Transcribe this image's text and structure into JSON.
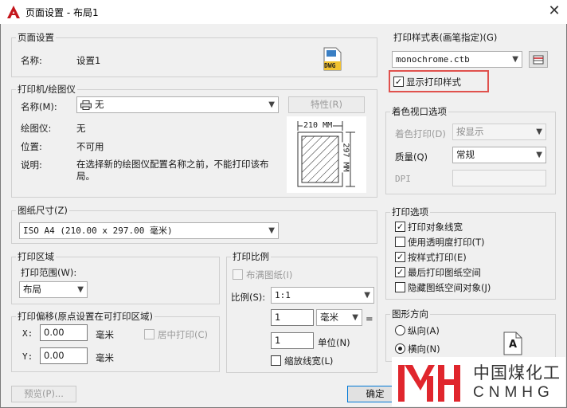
{
  "window": {
    "title": "页面设置 - 布局1",
    "close": "✕"
  },
  "page_setup": {
    "group": "页面设置",
    "name_label": "名称:",
    "name_value": "设置1",
    "icon_text": "DWG"
  },
  "printer": {
    "group": "打印机/绘图仪",
    "name_label": "名称(M):",
    "name_value": "无",
    "props_button": "特性(R)",
    "plotter_label": "绘图仪:",
    "plotter_value": "无",
    "location_label": "位置:",
    "location_value": "不可用",
    "desc_label": "说明:",
    "desc_value": "在选择新的绘图仪配置名称之前，不能打印该布局。",
    "paper_w": "210 MM",
    "paper_h": "297 MM"
  },
  "paper_size": {
    "group": "图纸尺寸(Z)",
    "value": "ISO A4 (210.00 x 297.00 毫米)"
  },
  "plot_area": {
    "group": "打印区域",
    "range_label": "打印范围(W):",
    "range_value": "布局"
  },
  "plot_offset": {
    "group": "打印偏移(原点设置在可打印区域)",
    "x_label": "X:",
    "x_value": "0.00",
    "x_unit": "毫米",
    "y_label": "Y:",
    "y_value": "0.00",
    "y_unit": "毫米",
    "center_label": "居中打印(C)"
  },
  "plot_scale": {
    "group": "打印比例",
    "fit_label": "布满图纸(I)",
    "scale_label": "比例(S):",
    "scale_value": "1:1",
    "value1": "1",
    "unit1": "毫米",
    "equals": "=",
    "value2": "1",
    "unit2": "单位(N)",
    "lineweights_label": "缩放线宽(L)"
  },
  "style_table": {
    "group": "打印样式表(画笔指定)(G)",
    "value": "monochrome.ctb",
    "display_label": "显示打印样式",
    "highlight_color": "#e0514d"
  },
  "shaded_viewport": {
    "group": "着色视口选项",
    "shade_label": "着色打印(D)",
    "shade_value": "按显示",
    "quality_label": "质量(Q)",
    "quality_value": "常规",
    "dpi_label": "DPI"
  },
  "plot_options": {
    "group": "打印选项",
    "items": [
      {
        "label": "打印对象线宽",
        "checked": "✓"
      },
      {
        "label": "使用透明度打印(T)",
        "checked": ""
      },
      {
        "label": "按样式打印(E)",
        "checked": "✓"
      },
      {
        "label": "最后打印图纸空间",
        "checked": "✓"
      },
      {
        "label": "隐藏图纸空间对象(J)",
        "checked": ""
      }
    ]
  },
  "orientation": {
    "group": "图形方向",
    "portrait": "纵向(A)",
    "landscape": "横向(N)",
    "icon_letter": "A"
  },
  "buttons": {
    "preview": "预览(P)...",
    "ok": "确定"
  },
  "watermark": {
    "text_cn": "中国煤化工",
    "text_en": "CNMHG",
    "color": "#e0262d"
  }
}
